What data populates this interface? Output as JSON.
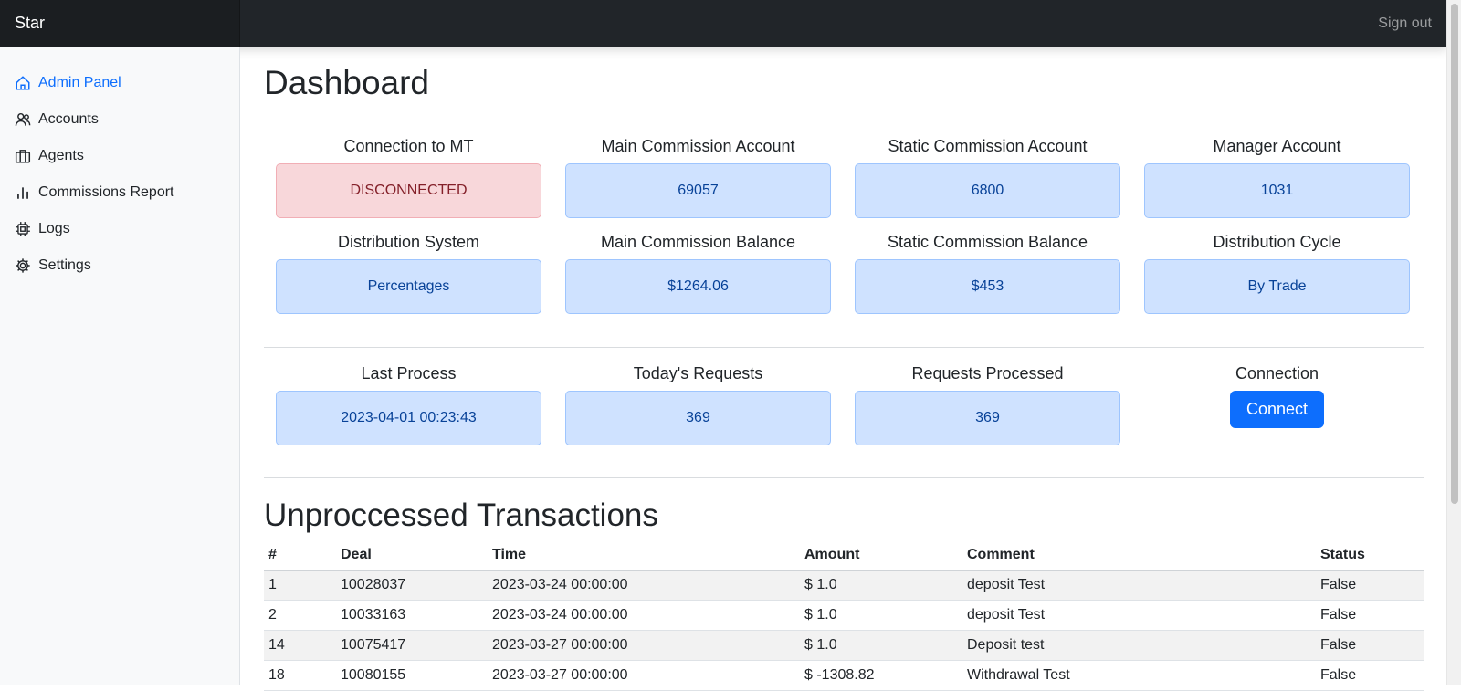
{
  "header": {
    "brand": "Star",
    "signout": "Sign out"
  },
  "sidebar": {
    "items": [
      {
        "label": "Admin Panel",
        "icon": "home-icon"
      },
      {
        "label": "Accounts",
        "icon": "users-icon"
      },
      {
        "label": "Agents",
        "icon": "briefcase-icon"
      },
      {
        "label": "Commissions Report",
        "icon": "bar-chart-icon"
      },
      {
        "label": "Logs",
        "icon": "cpu-icon"
      },
      {
        "label": "Settings",
        "icon": "gear-icon"
      }
    ]
  },
  "main": {
    "title": "Dashboard",
    "stats": [
      {
        "label": "Connection to MT",
        "value": "DISCONNECTED"
      },
      {
        "label": "Main Commission Account",
        "value": "69057"
      },
      {
        "label": "Static Commission Account",
        "value": "6800"
      },
      {
        "label": "Manager Account",
        "value": "1031"
      },
      {
        "label": "Distribution System",
        "value": "Percentages"
      },
      {
        "label": "Main Commission Balance",
        "value": "$1264.06"
      },
      {
        "label": "Static Commission Balance",
        "value": "$453"
      },
      {
        "label": "Distribution Cycle",
        "value": "By Trade"
      }
    ],
    "process": [
      {
        "label": "Last Process",
        "value": "2023-04-01 00:23:43"
      },
      {
        "label": "Today's Requests",
        "value": "369"
      },
      {
        "label": "Requests Processed",
        "value": "369"
      }
    ],
    "connection": {
      "label": "Connection",
      "button": "Connect"
    },
    "transactions": {
      "title": "Unproccessed Transactions",
      "columns": [
        "#",
        "Deal",
        "Time",
        "Amount",
        "Comment",
        "Status"
      ],
      "rows": [
        [
          "1",
          "10028037",
          "2023-03-24 00:00:00",
          "$ 1.0",
          "deposit Test",
          "False"
        ],
        [
          "2",
          "10033163",
          "2023-03-24 00:00:00",
          "$ 1.0",
          "deposit Test",
          "False"
        ],
        [
          "14",
          "10075417",
          "2023-03-27 00:00:00",
          "$ 1.0",
          "Deposit test",
          "False"
        ],
        [
          "18",
          "10080155",
          "2023-03-27 00:00:00",
          "$ -1308.82",
          "Withdrawal Test",
          "False"
        ]
      ]
    }
  },
  "colors": {
    "accent": "#0d6efd",
    "info_bg": "#cfe2ff",
    "info_text": "#084298",
    "danger_bg": "#f8d7da",
    "danger_text": "#842029",
    "topbar": "#212529"
  }
}
